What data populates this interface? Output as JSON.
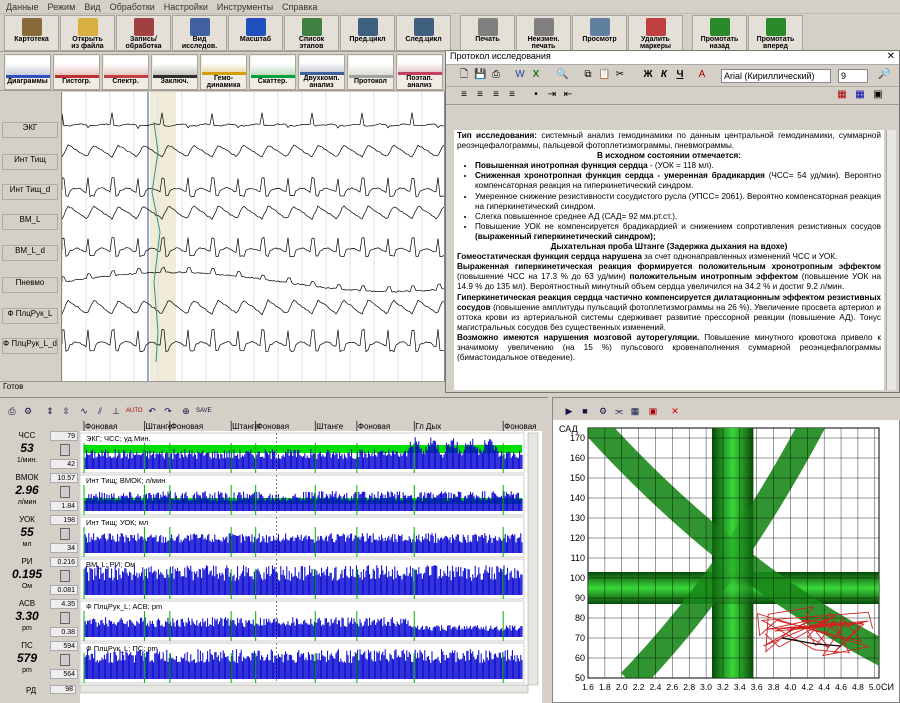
{
  "menu": [
    "Данные",
    "Режим",
    "Вид",
    "Обработки",
    "Настройки",
    "Инструменты",
    "Справка"
  ],
  "toolbar_main": [
    {
      "label": "Картотека",
      "icon": "card-index-icon",
      "color": "#8a6a3a"
    },
    {
      "label": "Открыть\nиз файла",
      "icon": "open-file-icon",
      "color": "#d8b040"
    },
    {
      "label": "Запись/\nобработка",
      "icon": "record-icon",
      "color": "#a04040"
    },
    {
      "label": "Вид\nисследов.",
      "icon": "study-view-icon",
      "color": "#4060a0"
    },
    {
      "label": "Масштаб",
      "icon": "zoom-icon",
      "color": "#2050c0"
    },
    {
      "label": "Список\nэтапов",
      "icon": "stage-list-icon",
      "color": "#408040"
    },
    {
      "label": "Пред.цикл",
      "icon": "prev-cycle-icon",
      "color": "#406080"
    },
    {
      "label": "След.цикл",
      "icon": "next-cycle-icon",
      "color": "#406080"
    },
    {
      "label": "Печать",
      "icon": "printer-icon",
      "color": "#808080"
    },
    {
      "label": "Неизмен.\nпечать",
      "icon": "print-unchanged-icon",
      "color": "#808080"
    },
    {
      "label": "Просмотр",
      "icon": "preview-icon",
      "color": "#6080a0"
    },
    {
      "label": "Удалить\nмаркеры",
      "icon": "delete-markers-icon",
      "color": "#c04040"
    },
    {
      "label": "Промотать\nназад",
      "icon": "rewind-icon",
      "color": "#2a8a2a"
    },
    {
      "label": "Промотать\nвперед",
      "icon": "forward-icon",
      "color": "#2a8a2a"
    }
  ],
  "toolbar_views": [
    {
      "label": "Диаграммы",
      "icon": "diagrams-icon"
    },
    {
      "label": "Гистогр.",
      "icon": "histogram-icon"
    },
    {
      "label": "Спектр.",
      "icon": "spectrum-icon"
    },
    {
      "label": "Заключ.",
      "icon": "conclusion-icon"
    },
    {
      "label": "Гемо-\nдинамика",
      "icon": "hemodynamics-icon"
    },
    {
      "label": "Скаттер.",
      "icon": "scatter-icon"
    },
    {
      "label": "Двухкомп.\nанализ",
      "icon": "two-component-icon"
    },
    {
      "label": "Протокол",
      "icon": "protocol-icon"
    },
    {
      "label": "Поэтап.\nанализ",
      "icon": "stage-analysis-icon"
    }
  ],
  "ecg_channels": [
    "ЭКГ",
    "Инт Тищ",
    "Инт Тищ_d",
    "ВМ_L",
    "ВМ_L_d",
    "Пневмо",
    "Ф ПлцРук_L",
    "Ф ПлцРук_L_d"
  ],
  "status": "Готов",
  "protocol": {
    "title": "Протокол исследования",
    "font_name": "Arial (Кириллический)",
    "font_size": "9",
    "paragraphs": [
      {
        "html": "<b>Тип исследования:</b> системный анализ гемодинамики по данным центральной гемодинамики, суммарной реоэнцефалограммы, пальцевой фотоплетизмограммы, пневмограммы."
      },
      {
        "html": "<b>В исходном состоянии отмечается:</b>",
        "center": true
      },
      {
        "html": "<b>Повышенная инотропная функция сердца</b> - (УОК = 118 мл).",
        "li": true
      },
      {
        "html": "<b>Сниженная хронотропная функция сердца - умеренная брадикардия</b> (ЧСС= 54 уд/мин). Вероятно компенсаторная реакция на гиперкинетический синдром.",
        "li": true
      },
      {
        "html": "Умеренное снижение резистивности сосудистого русла (УПСС= 2061). Вероятно компенсаторная реакция на гиперкинетический синдром.",
        "li": true
      },
      {
        "html": "Слегка повышенное среднее АД (САД= 92 мм.рт.ст.).",
        "li": true
      },
      {
        "html": "Повышение УОК не компенсируется брадикардией и снижением сопротивления резистивных сосудов <b>(выраженный гиперкинетический синдром);</b>",
        "li": true
      },
      {
        "html": "<b>Дыхательная проба Штанге (Задержка дыхания на вдохе)</b>",
        "center": true
      },
      {
        "html": "<b>Гомеостатическая функция сердца нарушена</b> за счет однонаправленных изменений ЧСС и УОК."
      },
      {
        "html": "<b>Выраженная гиперкинетическая реакция формируется положительным хронотропным эффектом</b> (повышение ЧСС на 17.3 % до 63 уд/мин) <b>положительным инотропным эффектом</b> (повышение УОК на 14.9 % до 135 мл). Вероятностный минутный объем сердца увеличился на 34.2 % и достиг 9.2 л/мин."
      },
      {
        "html": "<b>Гиперкинетическая реакция сердца частично компенсируется дилатационным эффектом резистивных сосудов</b> (повышение амплитуды пульсаций фотоплетизмограммы на 26 %). Увеличение просвета артериол и оттока крови из артериальной системы сдерживает развитие прессорной реакции (повышение АД). Тонус магистральных сосудов без существенных изменений."
      },
      {
        "html": "<b>Возможно имеются нарушения мозговой ауторегуляции.</b> Повышение минутного кровотока привело к значимому увеличению (на 15 %) пульсового кровенаполнения суммарной реоэнцефалограммы (бимастоидальное отведение)."
      }
    ]
  },
  "trend_labels": [
    {
      "name": "ЧСС",
      "value": "53",
      "unit": "1/мин.",
      "hi": "79",
      "lo": "42"
    },
    {
      "name": "ВМОК",
      "value": "2.96",
      "unit": "л/мин",
      "hi": "10.57",
      "lo": "1.84"
    },
    {
      "name": "УОК",
      "value": "55",
      "unit": "мл",
      "hi": "198",
      "lo": "34"
    },
    {
      "name": "РИ",
      "value": "0.195",
      "unit": "Ом",
      "hi": "0.216",
      "lo": "0.081"
    },
    {
      "name": "АСВ",
      "value": "3.30",
      "unit": "pm",
      "hi": "4.35",
      "lo": "0.38"
    },
    {
      "name": "ПС",
      "value": "579",
      "unit": "pm",
      "hi": "594",
      "lo": "564"
    }
  ],
  "trend_footer": {
    "name": "РД",
    "value": "98"
  },
  "stage_labels": [
    {
      "text": "Фоновая",
      "pos": 0.0
    },
    {
      "text": "Штанге",
      "pos": 0.138
    },
    {
      "text": "Фоновая",
      "pos": 0.196
    },
    {
      "text": "Штанге",
      "pos": 0.336
    },
    {
      "text": "Фоновая",
      "pos": 0.392
    },
    {
      "text": "Штанге",
      "pos": 0.528
    },
    {
      "text": "Фоновая",
      "pos": 0.623
    },
    {
      "text": "Гл Дых",
      "pos": 0.754
    },
    {
      "text": "Фоновая",
      "pos": 0.957
    }
  ],
  "trend_channels": [
    "ЭКГ; ЧСС; уд.Мин.",
    "Инт Тищ; ВМОК; л/мин",
    "Инт Тищ; УОК; мл",
    "ВМ_L; РИ; Ом",
    "Ф ПлцРук_L; АСВ; pm",
    "Ф ПлцРук_L; ПС; pm"
  ],
  "xy_plot": {
    "ylabel": "САД",
    "xlabel": "СИ",
    "yticks": [
      50,
      60,
      70,
      80,
      90,
      100,
      110,
      120,
      130,
      140,
      150,
      160,
      170
    ],
    "xticks": [
      "1.6",
      "1.8",
      "2.0",
      "2.2",
      "2.4",
      "2.6",
      "2.8",
      "3.0",
      "3.2",
      "3.4",
      "3.6",
      "3.8",
      "4.0",
      "4.2",
      "4.4",
      "4.6",
      "4.8",
      "5.0"
    ]
  }
}
